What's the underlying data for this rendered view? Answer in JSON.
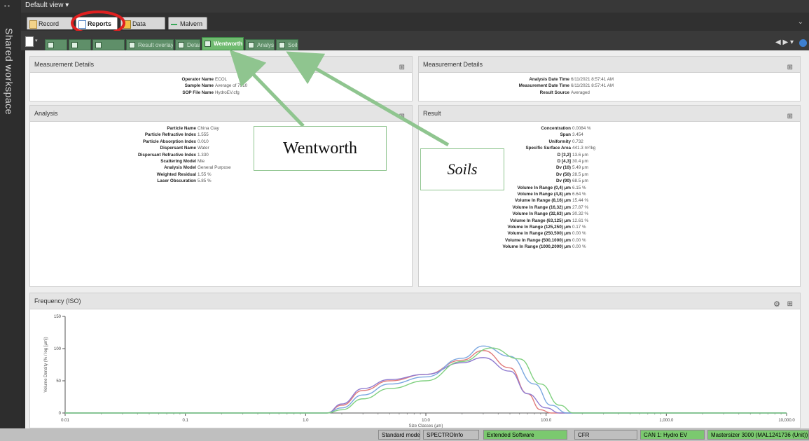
{
  "app": {
    "view_selector": "Default view",
    "sidebar_label": "Shared workspace"
  },
  "main_tabs": [
    {
      "label": "Record View",
      "active": false
    },
    {
      "label": "Reports",
      "active": true
    },
    {
      "label": "Data Quality",
      "active": false
    },
    {
      "label": "Malvern",
      "active": false
    }
  ],
  "report_tabs": [
    {
      "label": "",
      "active": false
    },
    {
      "label": "",
      "active": false
    },
    {
      "label": "",
      "active": false
    },
    {
      "label": "Result overlay",
      "active": false
    },
    {
      "label": "Detail",
      "active": false
    },
    {
      "label": "Wentworth",
      "active": true
    },
    {
      "label": "Analysis",
      "active": false
    },
    {
      "label": "Soils",
      "active": false
    }
  ],
  "measurement_left": {
    "title": "Measurement Details",
    "rows": [
      {
        "k": "Operator Name",
        "v": "ECOL"
      },
      {
        "k": "Sample Name",
        "v": "Average of 7910"
      },
      {
        "k": "SOP File Name",
        "v": "HydroEV.cfg"
      }
    ]
  },
  "measurement_right": {
    "title": "Measurement Details",
    "rows": [
      {
        "k": "Analysis Date Time",
        "v": "6/11/2021 8:57:41 AM"
      },
      {
        "k": "Measurement Date Time",
        "v": "6/11/2021 8:57:41 AM"
      },
      {
        "k": "Result Source",
        "v": "Averaged"
      }
    ]
  },
  "analysis": {
    "title": "Analysis",
    "rows": [
      {
        "k": "Particle Name",
        "v": "China Clay"
      },
      {
        "k": "Particle Refractive Index",
        "v": "1.555"
      },
      {
        "k": "Particle Absorption Index",
        "v": "0.010"
      },
      {
        "k": "Dispersant Name",
        "v": "Water"
      },
      {
        "k": "Dispersant Refractive Index",
        "v": "1.330"
      },
      {
        "k": "Scattering Model",
        "v": "Mie"
      },
      {
        "k": "Analysis Model",
        "v": "General Purpose"
      },
      {
        "k": "Weighted Residual",
        "v": "1.55 %"
      },
      {
        "k": "Laser Obscuration",
        "v": "5.85 %"
      }
    ]
  },
  "result": {
    "title": "Result",
    "rows": [
      {
        "k": "Concentration",
        "v": "0.0084 %"
      },
      {
        "k": "Span",
        "v": "3.454"
      },
      {
        "k": "Uniformity",
        "v": "0.732"
      },
      {
        "k": "Specific Surface Area",
        "v": "441.3 m²/kg"
      },
      {
        "k": "D [3,2]",
        "v": "13.6 μm"
      },
      {
        "k": "D [4,3]",
        "v": "30.4 μm"
      },
      {
        "k": "Dv (10)",
        "v": "5.49 μm"
      },
      {
        "k": "Dv (50)",
        "v": "28.5 μm"
      },
      {
        "k": "Dv (90)",
        "v": "68.5 μm"
      },
      {
        "k": "Volume In Range (0,4) μm",
        "v": "6.15 %"
      },
      {
        "k": "Volume In Range (4,8) μm",
        "v": "6.64 %"
      },
      {
        "k": "Volume In Range (8,16) μm",
        "v": "15.44 %"
      },
      {
        "k": "Volume In Range (16,32) μm",
        "v": "27.87 %"
      },
      {
        "k": "Volume In Range (32,63) μm",
        "v": "30.32 %"
      },
      {
        "k": "Volume In Range (63,125) μm",
        "v": "12.61 %"
      },
      {
        "k": "Volume In Range (125,250) μm",
        "v": "0.17 %"
      },
      {
        "k": "Volume In Range (250,500) μm",
        "v": "0.00 %"
      },
      {
        "k": "Volume In Range (500,1000) μm",
        "v": "0.00 %"
      },
      {
        "k": "Volume In Range (1000,2000) μm",
        "v": "0.00 %"
      }
    ]
  },
  "frequency": {
    "title": "Frequency (ISO)"
  },
  "chart_data": {
    "type": "line",
    "title": "",
    "xlabel": "Size Classes (μm)",
    "ylabel": "Volume Density (% / log [μm])",
    "x_scale": "log",
    "xlim": [
      0.01,
      10000
    ],
    "ylim": [
      0,
      150
    ],
    "x_tick_labels": [
      "0.01",
      "0.1",
      "1.0",
      "10.0",
      "100.0",
      "1,000.0",
      "10,000.0"
    ],
    "y_tick_labels": [
      "0",
      "50",
      "100",
      "150"
    ],
    "series": [
      {
        "color": "#e07b7b",
        "x": [
          0.01,
          1.5,
          2,
          3,
          5,
          10,
          20,
          30,
          50,
          70,
          90,
          110
        ],
        "y": [
          0,
          0,
          12,
          35,
          50,
          60,
          82,
          97,
          70,
          30,
          5,
          0
        ]
      },
      {
        "color": "#8f7bd0",
        "x": [
          0.01,
          1.5,
          2,
          3,
          5,
          10,
          20,
          30,
          50,
          70,
          100,
          130
        ],
        "y": [
          0,
          0,
          14,
          38,
          52,
          60,
          78,
          86,
          65,
          30,
          8,
          0
        ]
      },
      {
        "color": "#7ba7e0",
        "x": [
          0.01,
          1.5,
          2,
          3,
          5,
          10,
          20,
          30,
          50,
          80,
          110,
          150
        ],
        "y": [
          0,
          0,
          8,
          28,
          45,
          56,
          85,
          104,
          88,
          45,
          12,
          0
        ]
      },
      {
        "color": "#7fd07f",
        "x": [
          0.01,
          1.5,
          2,
          3,
          5,
          10,
          20,
          35,
          60,
          90,
          130,
          170
        ],
        "y": [
          0,
          0,
          5,
          22,
          38,
          50,
          80,
          101,
          84,
          45,
          12,
          0
        ]
      }
    ]
  },
  "annotations": {
    "wentworth": "Wentworth",
    "soils": "Soils"
  },
  "status_bar": [
    {
      "label": "Standard mode",
      "color": "#bfbfbf"
    },
    {
      "label": "SPECTROInfo",
      "color": "#bfbfbf"
    },
    {
      "label": "Extended Software",
      "color": "#7bc96f"
    },
    {
      "label": "CFR",
      "color": "#bfbfbf"
    },
    {
      "label": "CAN 1: Hydro EV",
      "color": "#7bc96f"
    },
    {
      "label": "Mastersizer 3000 (MAL1241736 (Unit))",
      "color": "#7bc96f"
    }
  ],
  "colors": {
    "active_subtab": "#6fba6f",
    "callout_arrow": "#8fc58f",
    "highlight_circle": "#e02020"
  }
}
